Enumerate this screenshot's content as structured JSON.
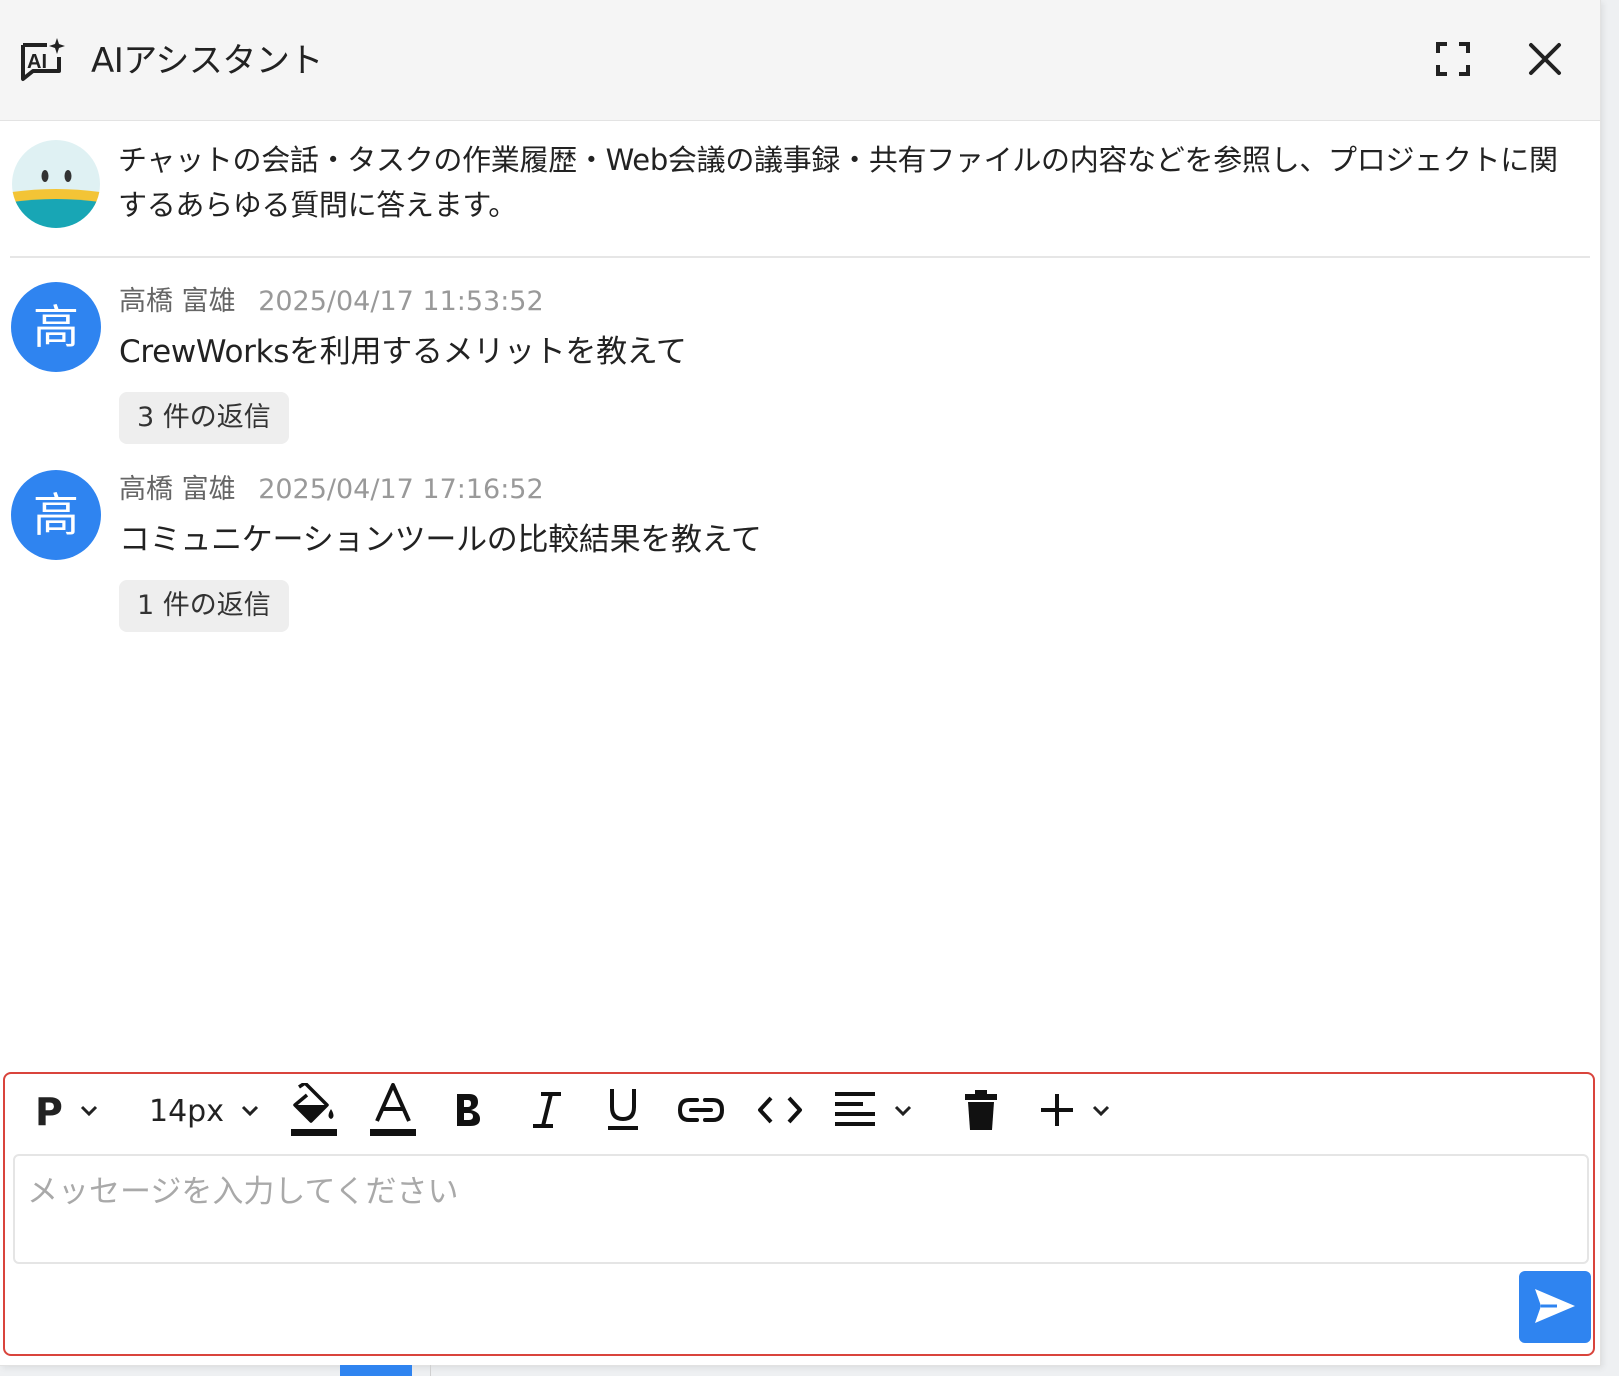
{
  "header": {
    "title": "AIアシスタント",
    "icon": "ai-sparkle-icon",
    "expand_icon": "fullscreen-icon",
    "close_icon": "close-icon"
  },
  "intro": {
    "text": "チャットの会話・タスクの作業履歴・Web会議の議事録・共有ファイルの内容などを参照し、プロジェクトに関するあらゆる質問に答えます。"
  },
  "messages": [
    {
      "avatar_text": "高",
      "author": "高橋 富雄",
      "time": "2025/04/17 11:53:52",
      "text": "CrewWorksを利用するメリットを教えて",
      "replies": "3 件の返信"
    },
    {
      "avatar_text": "高",
      "author": "高橋 富雄",
      "time": "2025/04/17 17:16:52",
      "text": "コミュニケーションツールの比較結果を教えて",
      "replies": "1 件の返信"
    }
  ],
  "toolbar": {
    "block_format": "P",
    "font_size": "14px"
  },
  "composer": {
    "placeholder": "メッセージを入力してください",
    "value": ""
  },
  "colors": {
    "accent": "#2f84f0",
    "composer_border": "#d9443c",
    "header_bg": "#f5f5f5"
  }
}
